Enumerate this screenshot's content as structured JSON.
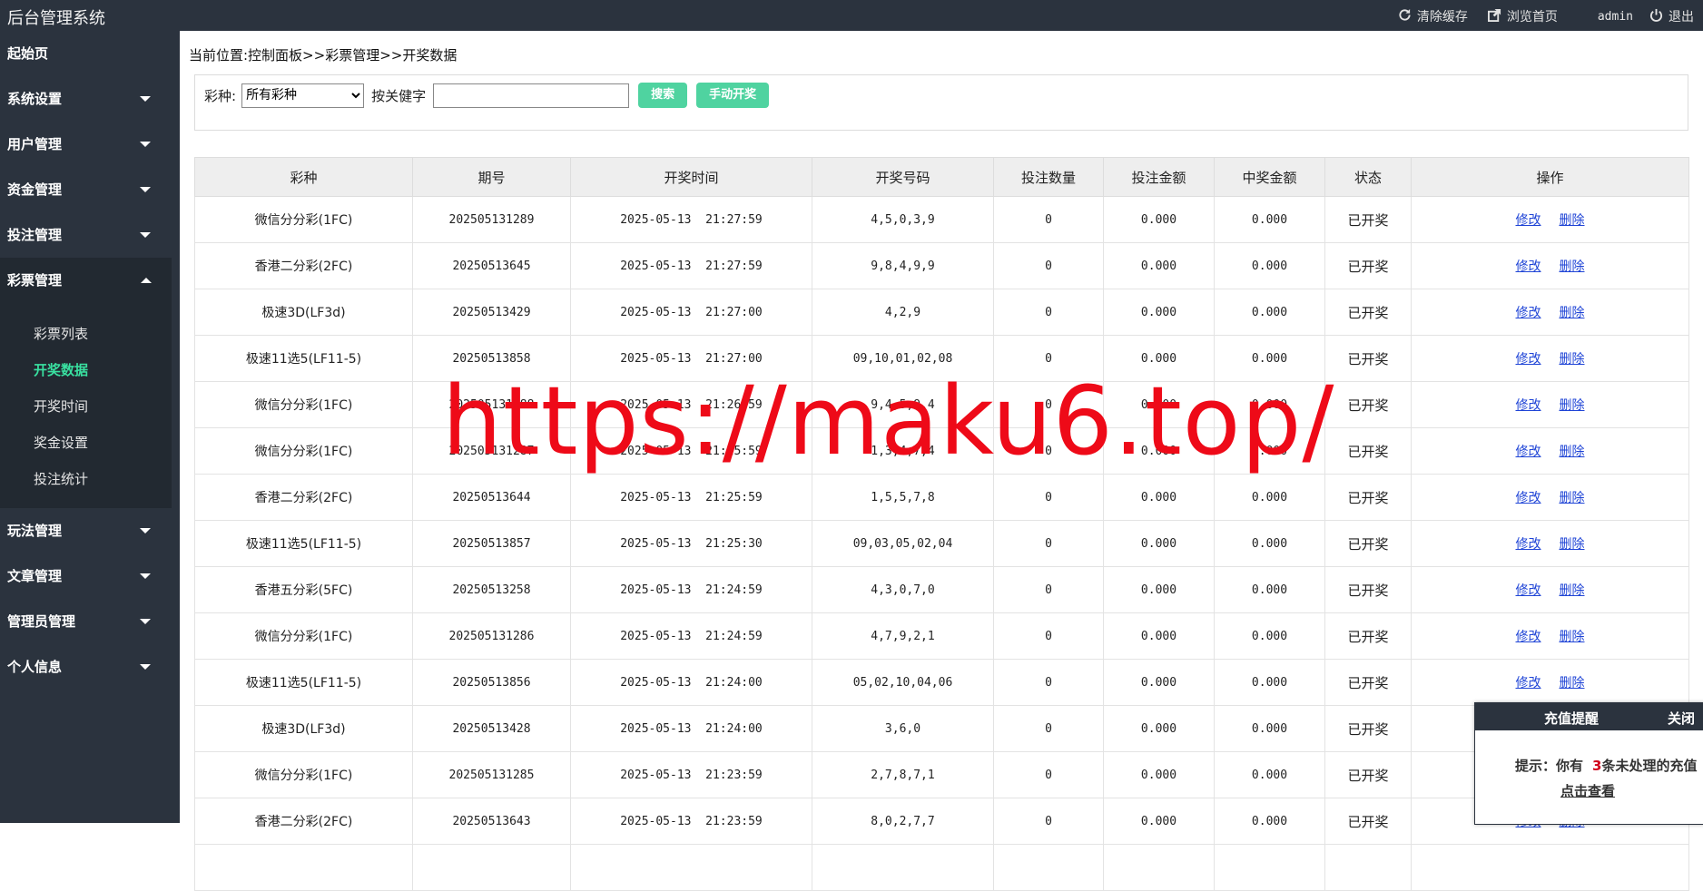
{
  "topbar": {
    "title": "后台管理系统",
    "actions": [
      {
        "label": "清除缓存",
        "icon": "refresh-icon"
      },
      {
        "label": "浏览首页",
        "icon": "external-link-icon"
      }
    ],
    "user": "admin",
    "logout_label": "退出"
  },
  "sidebar": {
    "top_items": [
      {
        "label": "起始页"
      },
      {
        "label": "系统设置"
      },
      {
        "label": "用户管理"
      },
      {
        "label": "资金管理"
      },
      {
        "label": "投注管理"
      }
    ],
    "open_item": {
      "label": "彩票管理"
    },
    "sub_items": [
      {
        "label": "彩票列表"
      },
      {
        "label": "开奖数据"
      },
      {
        "label": "开奖时间"
      },
      {
        "label": "奖金设置"
      },
      {
        "label": "投注统计"
      }
    ],
    "bottom_items": [
      {
        "label": "玩法管理"
      },
      {
        "label": "文章管理"
      },
      {
        "label": "管理员管理"
      },
      {
        "label": "个人信息"
      }
    ]
  },
  "breadcrumb": "当前位置:控制面板>>彩票管理>>开奖数据",
  "search": {
    "lottery_label": "彩种:",
    "lottery_selected": "所有彩种",
    "keyword_label": "按关健字",
    "keyword_value": "",
    "search_button": "搜索",
    "manual_button": "手动开奖"
  },
  "table": {
    "headers": [
      "彩种",
      "期号",
      "开奖时间",
      "开奖号码",
      "投注数量",
      "投注金额",
      "中奖金额",
      "状态",
      "操作"
    ],
    "edit_label": "修改",
    "delete_label": "删除",
    "rows": [
      [
        "微信分分彩(1FC)",
        "202505131289",
        "2025-05-13  21:27:59",
        "4,5,0,3,9",
        "0",
        "0.000",
        "0.000",
        "已开奖"
      ],
      [
        "香港二分彩(2FC)",
        "20250513645",
        "2025-05-13  21:27:59",
        "9,8,4,9,9",
        "0",
        "0.000",
        "0.000",
        "已开奖"
      ],
      [
        "极速3D(LF3d)",
        "20250513429",
        "2025-05-13  21:27:00",
        "4,2,9",
        "0",
        "0.000",
        "0.000",
        "已开奖"
      ],
      [
        "极速11选5(LF11-5)",
        "20250513858",
        "2025-05-13  21:27:00",
        "09,10,01,02,08",
        "0",
        "0.000",
        "0.000",
        "已开奖"
      ],
      [
        "微信分分彩(1FC)",
        "202505131288",
        "2025-05-13  21:26:59",
        "9,4,5,9,4",
        "0",
        "0.000",
        "0.000",
        "已开奖"
      ],
      [
        "微信分分彩(1FC)",
        "202505131287",
        "2025-05-13  21:25:59",
        "1,3,4,7,4",
        "0",
        "0.000",
        "0.000",
        "已开奖"
      ],
      [
        "香港二分彩(2FC)",
        "20250513644",
        "2025-05-13  21:25:59",
        "1,5,5,7,8",
        "0",
        "0.000",
        "0.000",
        "已开奖"
      ],
      [
        "极速11选5(LF11-5)",
        "20250513857",
        "2025-05-13  21:25:30",
        "09,03,05,02,04",
        "0",
        "0.000",
        "0.000",
        "已开奖"
      ],
      [
        "香港五分彩(5FC)",
        "20250513258",
        "2025-05-13  21:24:59",
        "4,3,0,7,0",
        "0",
        "0.000",
        "0.000",
        "已开奖"
      ],
      [
        "微信分分彩(1FC)",
        "202505131286",
        "2025-05-13  21:24:59",
        "4,7,9,2,1",
        "0",
        "0.000",
        "0.000",
        "已开奖"
      ],
      [
        "极速11选5(LF11-5)",
        "20250513856",
        "2025-05-13  21:24:00",
        "05,02,10,04,06",
        "0",
        "0.000",
        "0.000",
        "已开奖"
      ],
      [
        "极速3D(LF3d)",
        "20250513428",
        "2025-05-13  21:24:00",
        "3,6,0",
        "0",
        "0.000",
        "0.000",
        "已开奖"
      ],
      [
        "微信分分彩(1FC)",
        "202505131285",
        "2025-05-13  21:23:59",
        "2,7,8,7,1",
        "0",
        "0.000",
        "0.000",
        "已开奖"
      ],
      [
        "香港二分彩(2FC)",
        "20250513643",
        "2025-05-13  21:23:59",
        "8,0,2,7,7",
        "0",
        "0.000",
        "0.000",
        "已开奖"
      ],
      [
        "",
        "",
        "",
        "",
        "",
        "",
        "",
        ""
      ]
    ]
  },
  "watermark": "https://maku6.top/",
  "popup": {
    "title": "充值提醒",
    "close_label": "关闭",
    "text_prefix": "提示：你有",
    "count": "3",
    "text_suffix": "条未处理的充值",
    "link_label": "点击查看"
  },
  "colors": {
    "sidebar_bg": "#2b333e",
    "active_menu": "#39e0a0",
    "button": "#4fd3a0",
    "link": "#1f44d6",
    "watermark": "#ee0a18"
  }
}
